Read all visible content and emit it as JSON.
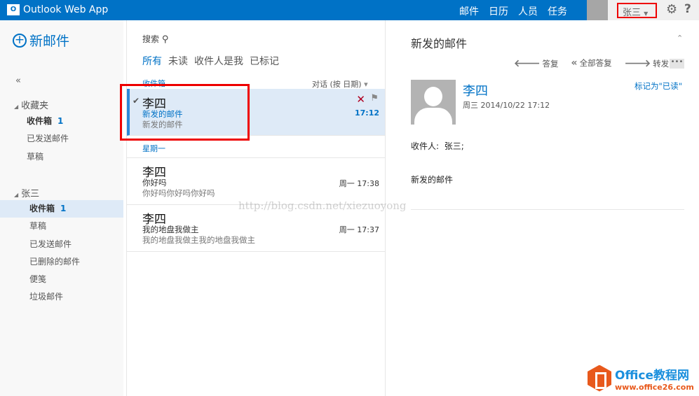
{
  "header": {
    "app_title": "Outlook Web App",
    "logo_glyph": "O",
    "nav": [
      "邮件",
      "日历",
      "人员",
      "任务"
    ],
    "user": "张三",
    "settings_icon": "gear-icon",
    "help": "?"
  },
  "sidebar": {
    "new_mail": "新邮件",
    "collapse": "«",
    "favorites": {
      "label": "收藏夹",
      "items": [
        {
          "label": "收件箱",
          "count": "1"
        },
        {
          "label": "已发送邮件"
        },
        {
          "label": "草稿"
        }
      ]
    },
    "account": {
      "label": "张三",
      "items": [
        {
          "label": "收件箱",
          "count": "1"
        },
        {
          "label": "草稿"
        },
        {
          "label": "已发送邮件"
        },
        {
          "label": "已删除的邮件"
        },
        {
          "label": "便笺"
        },
        {
          "label": "垃圾邮件"
        }
      ]
    }
  },
  "list": {
    "search": "搜索",
    "filters": [
      "所有",
      "未读",
      "收件人是我",
      "已标记"
    ],
    "folder": "收件箱",
    "sort": "对话 (按 日期)",
    "day_group": "星期一",
    "messages": [
      {
        "from": "李四",
        "subject": "新发的邮件",
        "preview": "新发的邮件",
        "time": "17:12"
      },
      {
        "from": "李四",
        "subject": "你好吗",
        "preview": "你好吗你好吗你好吗",
        "time": "周一 17:38"
      },
      {
        "from": "李四",
        "subject": "我的地盘我做主",
        "preview": "我的地盘我做主我的地盘我做主",
        "time": "周一 17:37"
      }
    ]
  },
  "reading": {
    "title": "新发的邮件",
    "reply": "答复",
    "reply_all": "全部答复",
    "forward": "转发",
    "more": "•••",
    "sender": "李四",
    "date": "周三 2014/10/22 17:12",
    "mark_read": "标记为\"已读\"",
    "to_label": "收件人:",
    "to": "张三;",
    "body": "新发的邮件"
  },
  "watermark": "http://blog.csdn.net/xiezuoyong",
  "brand": {
    "name": "Office教程网",
    "url": "www.office26.com"
  },
  "colors": {
    "accent": "#0072c6",
    "highlight": "#e00000",
    "selected": "#deeaf7"
  }
}
